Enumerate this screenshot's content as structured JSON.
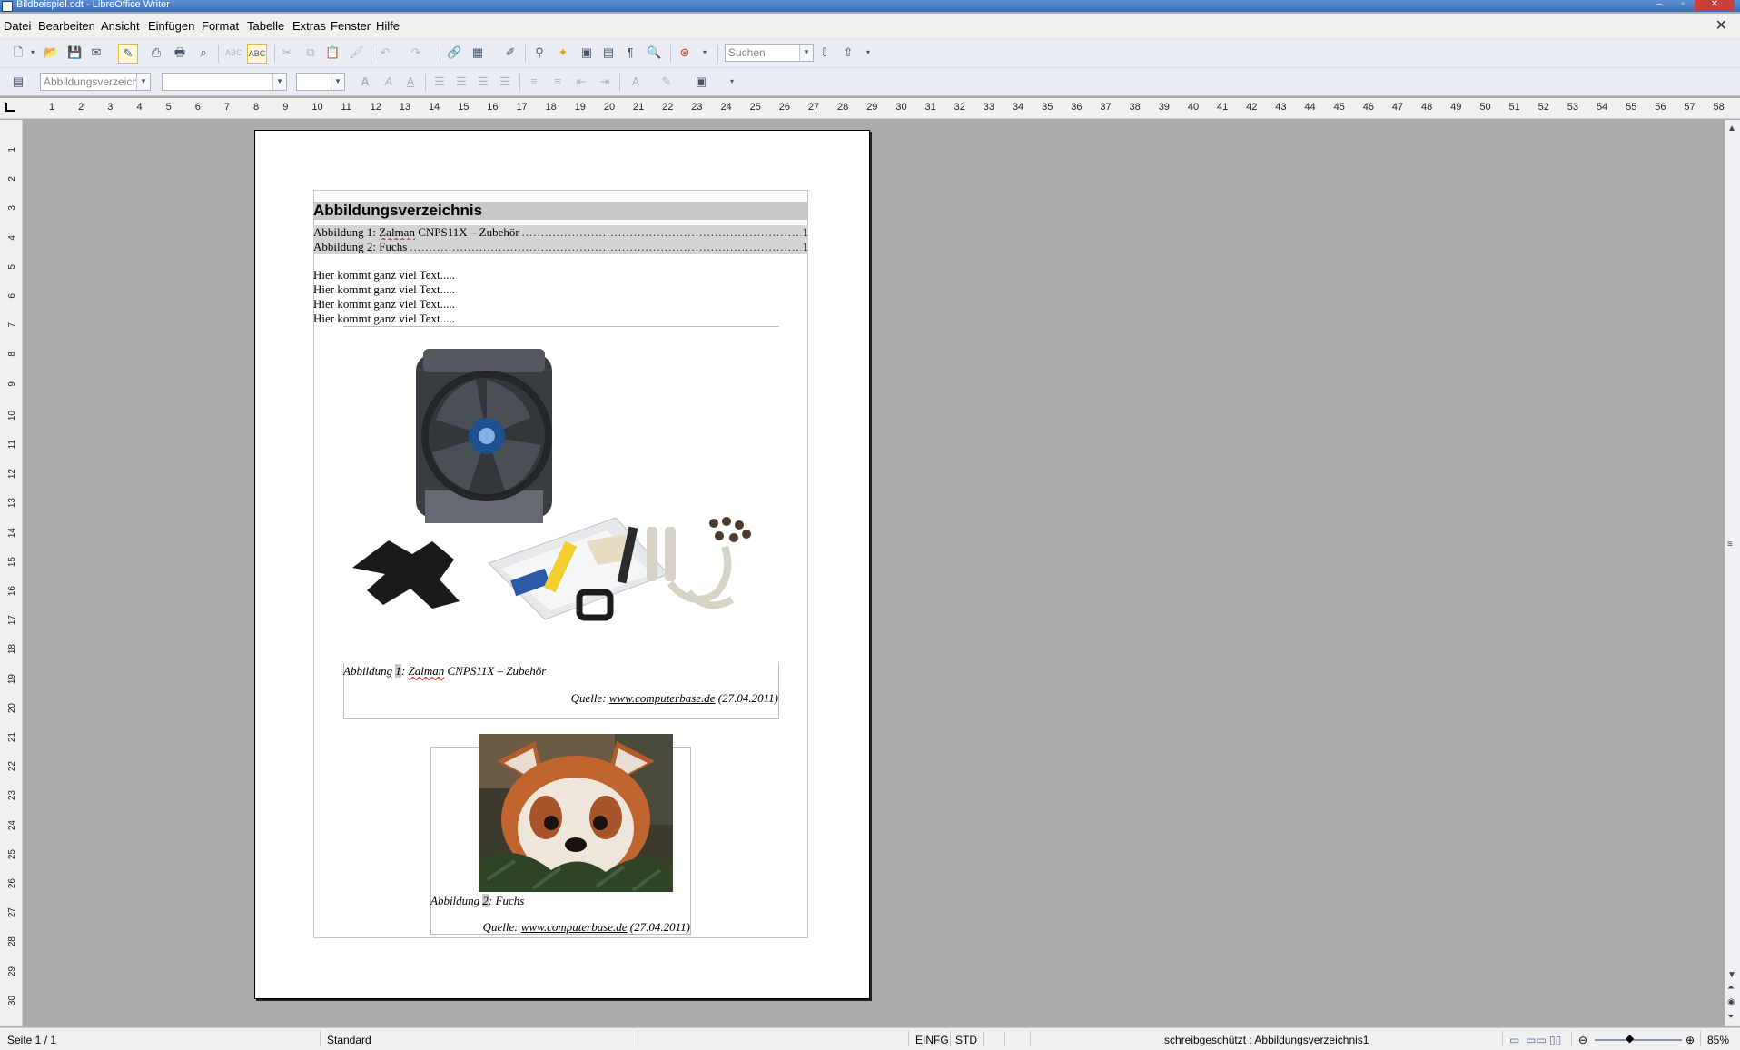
{
  "window": {
    "title": "Bildbeispiel.odt - LibreOffice Writer"
  },
  "menu": [
    "Datei",
    "Bearbeiten",
    "Ansicht",
    "Einfügen",
    "Format",
    "Tabelle",
    "Extras",
    "Fenster",
    "Hilfe"
  ],
  "toolbar": {
    "search_placeholder": "Suchen"
  },
  "format_toolbar": {
    "paragraph_style": "Abbildungsverzeich",
    "font_name": "",
    "font_size": ""
  },
  "ruler": {
    "h_ticks": [
      "1",
      "2",
      "3",
      "4",
      "5",
      "6",
      "7",
      "8",
      "9",
      "10",
      "11",
      "12",
      "13",
      "14",
      "15",
      "16",
      "17",
      "18",
      "19",
      "20",
      "21",
      "22",
      "23",
      "24",
      "25",
      "26",
      "27",
      "28",
      "29",
      "30",
      "31",
      "32",
      "33",
      "34",
      "35",
      "36",
      "37",
      "38",
      "39",
      "40",
      "41",
      "42",
      "43",
      "44",
      "45",
      "46",
      "47",
      "48",
      "49",
      "50",
      "51",
      "52",
      "53",
      "54",
      "55",
      "56",
      "57",
      "58"
    ],
    "v_ticks": [
      "1",
      "2",
      "3",
      "4",
      "5",
      "6",
      "7",
      "8",
      "9",
      "10",
      "11",
      "12",
      "13",
      "14",
      "15",
      "16",
      "17",
      "18",
      "19",
      "20",
      "21",
      "22",
      "23",
      "24",
      "25",
      "26",
      "27",
      "28",
      "29",
      "30"
    ]
  },
  "document": {
    "toc_title": "Abbildungsverzeichnis",
    "toc_entries": [
      {
        "prefix": "Abbildung 1: ",
        "word": "Zalman",
        "rest": " CNPS11X – Zubehör",
        "page": "1"
      },
      {
        "prefix": "Abbildung 2: ",
        "word": "",
        "rest": "Fuchs",
        "page": "1"
      }
    ],
    "body_lines": [
      "Hier kommt ganz viel Text.....",
      "Hier kommt ganz viel Text.....",
      "Hier kommt ganz viel Text.....",
      "Hier kommt ganz viel Text....."
    ],
    "figure1": {
      "label": "Abbildung ",
      "number": "1",
      "sep": ": ",
      "word": "Zalman",
      "text": " CNPS11X – Zubehör",
      "source_prefix": "Quelle: ",
      "source_link": "www.computerbase.de",
      "source_suffix": " (27.04.2011)"
    },
    "figure2": {
      "label": "Abbildung ",
      "number": "2",
      "text": ": Fuchs",
      "source_prefix": "Quelle: ",
      "source_link": "www.computerbase.de",
      "source_suffix": " (27.04.2011)"
    }
  },
  "status": {
    "page": "Seite 1 / 1",
    "style": "Standard",
    "insert_mode": "EINFG",
    "selection_mode": "STD",
    "info": "schreibgeschützt : Abbildungsverzeichnis1",
    "zoom": "85%"
  }
}
